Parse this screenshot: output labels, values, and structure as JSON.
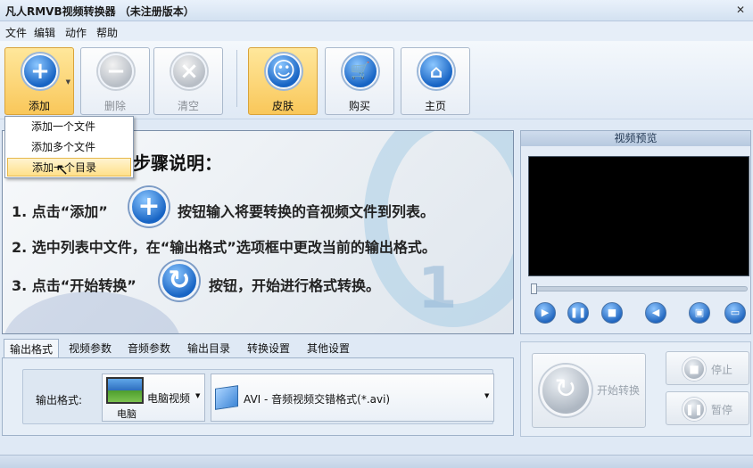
{
  "window": {
    "title": "凡人RMVB视频转换器 （未注册版本）",
    "close_glyph": "✕"
  },
  "menu": [
    "文件",
    "编辑",
    "动作",
    "帮助"
  ],
  "toolbar": {
    "add": "添加",
    "delete": "删除",
    "clear": "清空",
    "skin": "皮肤",
    "buy": "购买",
    "home": "主页"
  },
  "icons": {
    "add": "plus-icon",
    "delete": "minus-icon",
    "clear": "x-icon",
    "skin": "smiley-icon",
    "buy": "cart-icon",
    "home": "house-icon"
  },
  "add_menu": {
    "items": [
      "添加一个文件",
      "添加多个文件",
      "添加一个目录"
    ],
    "active_index": 2
  },
  "guide": {
    "heading": "步骤说明：",
    "step1_a": "1. 点击“添加”",
    "step1_b": "按钮输入将要转换的音视频文件到列表。",
    "step2": "2. 选中列表中文件，在“输出格式”选项框中更改当前的输出格式。",
    "step3_a": "3. 点击“开始转换”",
    "step3_b": "按钮，开始进行格式转换。",
    "watermark_number": "1"
  },
  "preview": {
    "title": "视频预览",
    "seek_position": 0.0
  },
  "tabs": [
    "输出格式",
    "视频参数",
    "音频参数",
    "输出目录",
    "转换设置",
    "其他设置"
  ],
  "output": {
    "label": "输出格式:",
    "device_caption": "电脑",
    "device_value": "电脑视频",
    "format_value": "AVI - 音频视频交错格式(*.avi)"
  },
  "convert": {
    "start": "开始转换",
    "stop": "停止",
    "pause": "暂停"
  },
  "colors": {
    "accent_blue": "#1764c4",
    "hover_orange": "#f9c75a",
    "window_bg": "#dfe9f5"
  }
}
